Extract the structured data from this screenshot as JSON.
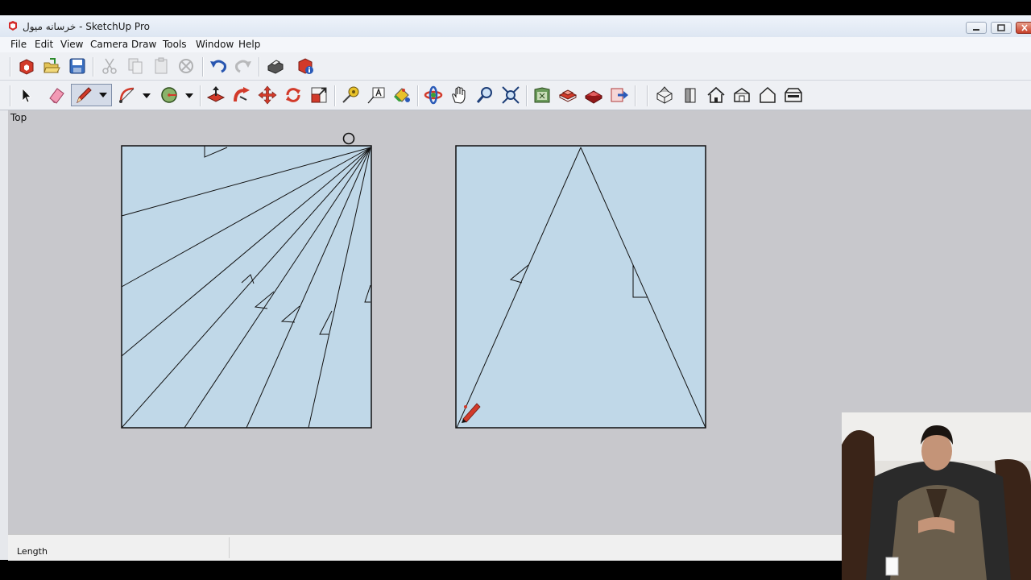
{
  "window": {
    "title": "خرسانه میول - SketchUp Pro"
  },
  "menu": [
    "File",
    "Edit",
    "View",
    "Camera",
    "Draw",
    "Tools",
    "Window",
    "Help"
  ],
  "toolbar_standard": [
    "new-icon",
    "open-icon",
    "save-icon",
    "cut-icon",
    "copy-icon",
    "paste-icon",
    "erase-selection-icon",
    "undo-icon",
    "redo-icon",
    "print-icon",
    "model-info-icon"
  ],
  "toolbar_large": [
    "select-icon",
    "eraser-icon",
    "pencil-icon",
    "arc-icon",
    "circle-icon",
    "push-pull-icon",
    "follow-me-icon",
    "move-icon",
    "rotate-icon",
    "scale-icon",
    "tape-measure-icon",
    "text-icon",
    "paint-bucket-icon",
    "orbit-icon",
    "pan-icon",
    "zoom-icon",
    "zoom-extents-icon",
    "warehouse-icon",
    "components-icon",
    "styles-icon",
    "send-to-layout-icon",
    "iso-view-icon",
    "front-view-icon",
    "top-view-icon",
    "right-view-icon",
    "back-view-icon",
    "left-view-icon"
  ],
  "viewport": {
    "view_name": "Top",
    "face_color": "#c0d8e8"
  },
  "status": {
    "vcb_label": "Length"
  },
  "colors": {
    "accent_red": "#cc2222",
    "titlebar": "#e4ebf5"
  }
}
